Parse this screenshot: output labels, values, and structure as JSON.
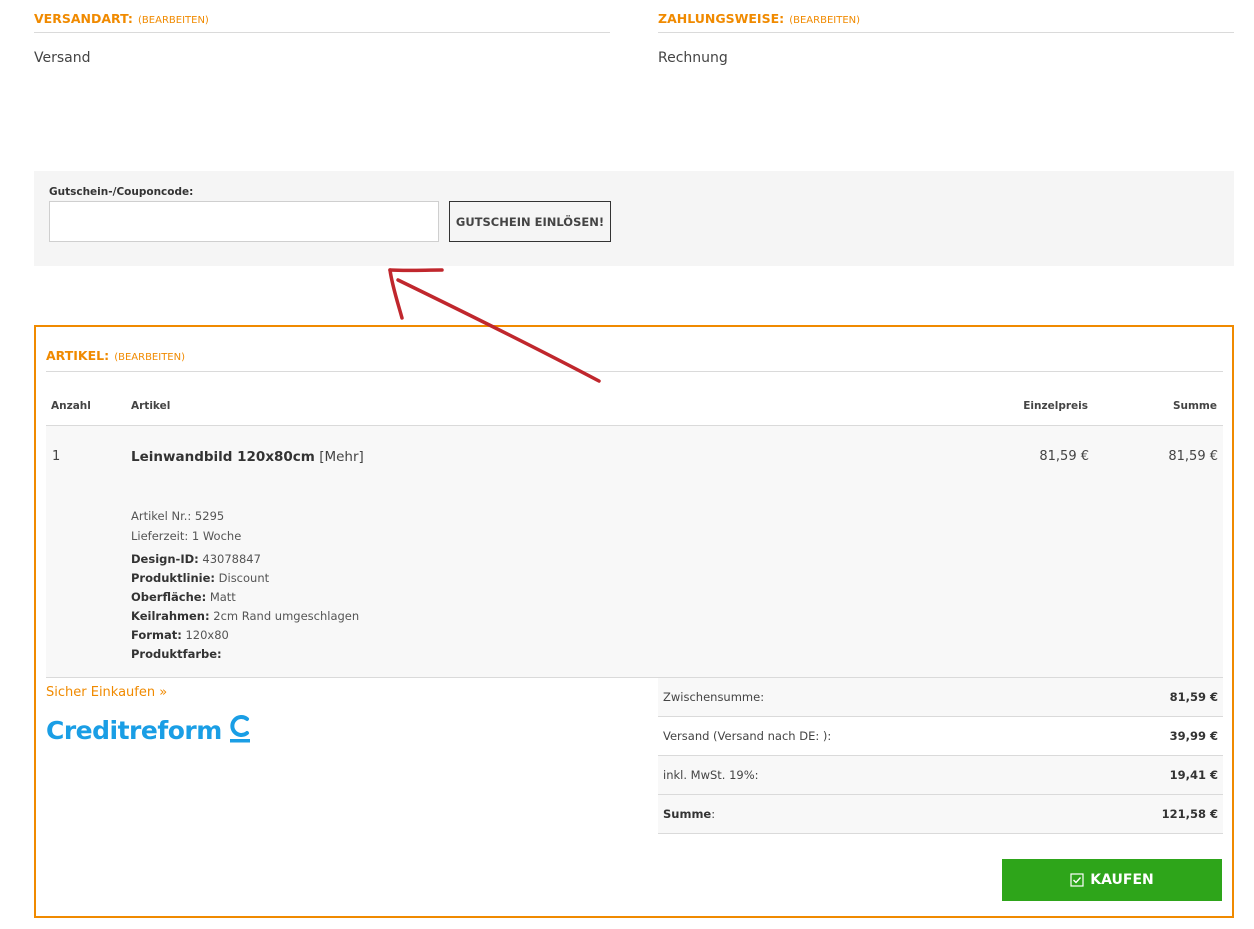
{
  "shipping": {
    "label": "VERSANDART:",
    "edit": "(BEARBEITEN)",
    "value": "Versand"
  },
  "payment": {
    "label": "ZAHLUNGSWEISE:",
    "edit": "(BEARBEITEN)",
    "value": "Rechnung"
  },
  "coupon": {
    "label": "Gutschein-/Couponcode:",
    "value": "",
    "button": "GUTSCHEIN EINLÖSEN!"
  },
  "articles": {
    "label": "ARTIKEL:",
    "edit": "(BEARBEITEN)",
    "columns": {
      "qty": "Anzahl",
      "article": "Artikel",
      "unit_price": "Einzelpreis",
      "sum": "Summe"
    },
    "items": [
      {
        "qty": "1",
        "name": "Leinwandbild 120x80cm",
        "more": "[Mehr]",
        "unit_price": "81,59 €",
        "sum": "81,59 €",
        "article_no": "Artikel Nr.: 5295",
        "delivery": "Lieferzeit: 1 Woche",
        "attributes": [
          {
            "key": "Design-ID:",
            "value": "43078847"
          },
          {
            "key": "Produktlinie:",
            "value": "Discount"
          },
          {
            "key": "Oberfläche:",
            "value": "Matt"
          },
          {
            "key": "Keilrahmen:",
            "value": "2cm Rand umgeschlagen"
          },
          {
            "key": "Format:",
            "value": "120x80"
          },
          {
            "key": "Produktfarbe:",
            "value": ""
          }
        ]
      }
    ]
  },
  "secure_link": "Sicher Einkaufen »",
  "logo_text": "Creditreform",
  "totals": [
    {
      "label": "Zwischensumme:",
      "value": "81,59 €"
    },
    {
      "label": "Versand (Versand nach DE: ):",
      "value": "39,99 €"
    },
    {
      "label": "inkl. MwSt. 19%:",
      "value": "19,41 €"
    },
    {
      "label_bold": "Summe",
      "label_suffix": ":",
      "value": "121,58 €"
    }
  ],
  "buy_button": "KAUFEN",
  "colors": {
    "accent": "#f08a00",
    "buy": "#2ea51a",
    "logo": "#1a9ee5",
    "annotation": "#c0272d"
  }
}
